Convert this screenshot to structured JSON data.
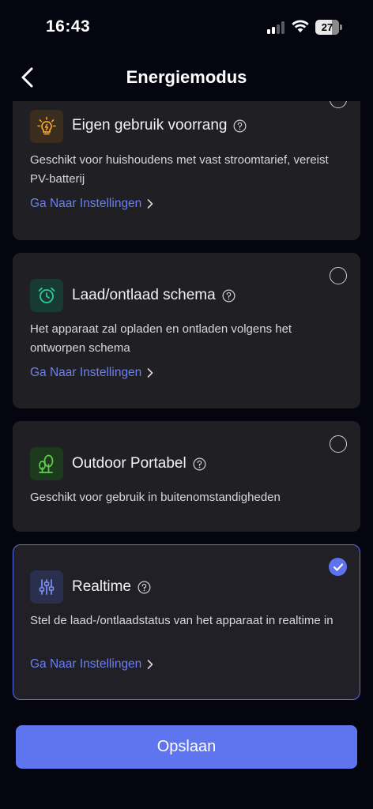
{
  "status_bar": {
    "time": "16:43",
    "battery": "27"
  },
  "nav": {
    "title": "Energiemodus"
  },
  "modes": [
    {
      "title": "Eigen gebruik voorrang",
      "description": "Geschikt voor huishoudens met vast stroomtarief, vereist PV-batterij",
      "link": "Ga Naar Instellingen",
      "icon": "lightbulb-icon",
      "icon_color": "#f0a32a",
      "selected": false
    },
    {
      "title": "Laad/ontlaad schema",
      "description": "Het apparaat zal opladen en ontladen volgens het ontworpen schema",
      "link": "Ga Naar Instellingen",
      "icon": "alarm-clock-icon",
      "icon_color": "#2ec89a",
      "selected": false
    },
    {
      "title": "Outdoor Portabel",
      "description": "Geschikt voor gebruik in buitenomstandigheden",
      "icon": "tree-icon",
      "icon_color": "#5fcf4c",
      "selected": false
    },
    {
      "title": "Realtime",
      "description": "Stel de laad-/ontlaadstatus van het apparaat in realtime in",
      "link": "Ga Naar Instellingen",
      "icon": "sliders-icon",
      "icon_color": "#6f7ff2",
      "selected": true
    }
  ],
  "save_label": "Opslaan",
  "colors": {
    "accent": "#5e75ef",
    "link": "#6b7ff2",
    "card_bg": "#202024",
    "page_bg": "#050510"
  }
}
